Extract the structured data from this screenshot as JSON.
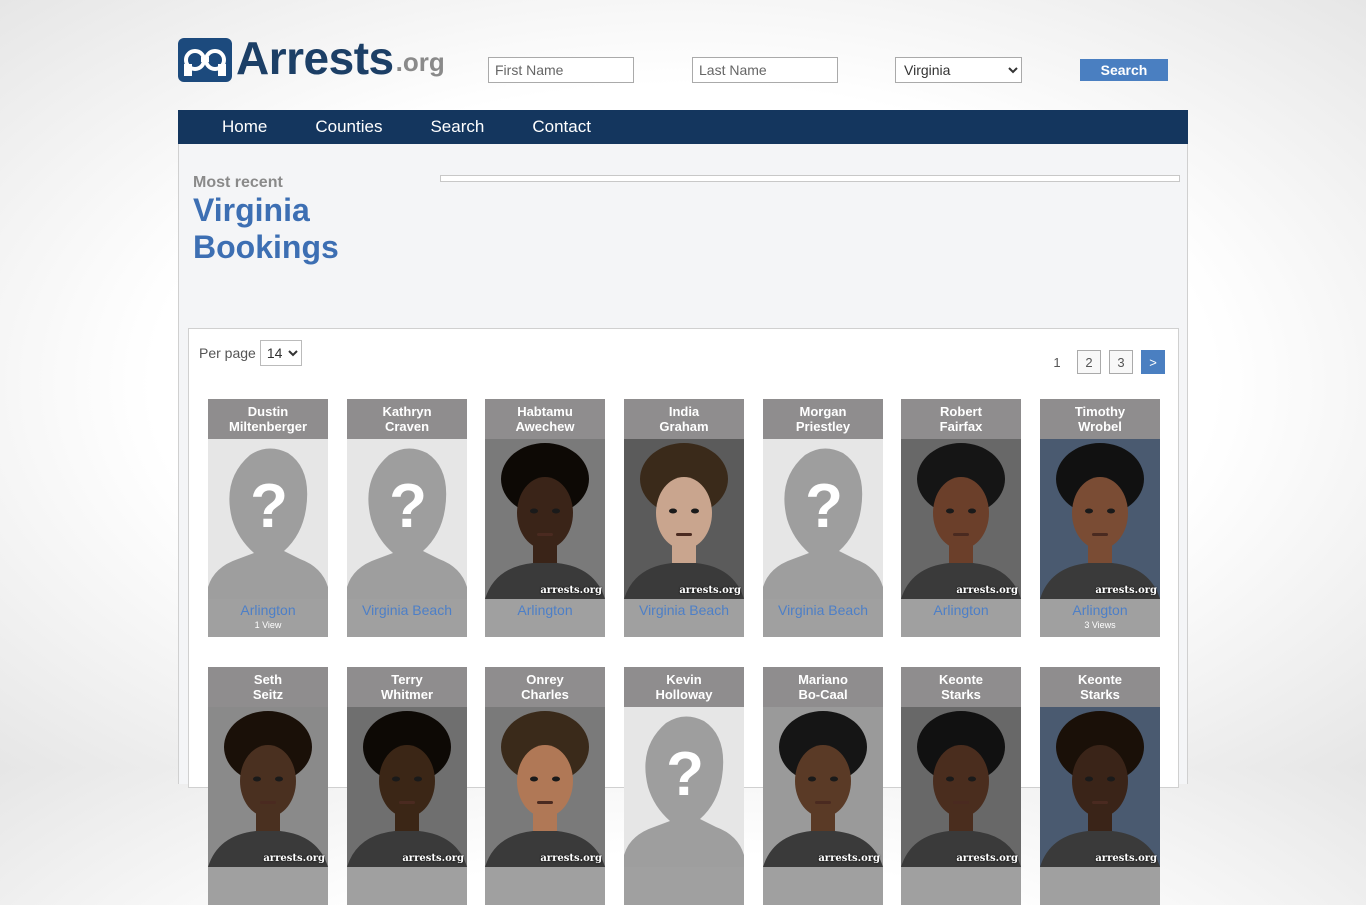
{
  "site": {
    "logo_text": "Arrests",
    "logo_tld": ".org"
  },
  "search": {
    "first_name_placeholder": "First Name",
    "last_name_placeholder": "Last Name",
    "state_selected": "Virginia",
    "button_label": "Search"
  },
  "nav": [
    "Home",
    "Counties",
    "Search",
    "Contact"
  ],
  "page": {
    "kicker": "Most recent",
    "title_line1": "Virginia",
    "title_line2": "Bookings"
  },
  "listing": {
    "per_page_label": "Per page",
    "per_page_value": "14",
    "pagination": {
      "current": "1",
      "pages": [
        "2",
        "3"
      ],
      "next": ">"
    }
  },
  "watermark": "arrests.org",
  "bookings": [
    {
      "first": "Dustin",
      "last": "Miltenberger",
      "county": "Arlington",
      "views": "1 View",
      "photo": "placeholder"
    },
    {
      "first": "Kathryn",
      "last": "Craven",
      "county": "Virginia Beach",
      "views": "",
      "photo": "placeholder"
    },
    {
      "first": "Habtamu",
      "last": "Awechew",
      "county": "Arlington",
      "views": "",
      "photo": "mugshot"
    },
    {
      "first": "India",
      "last": "Graham",
      "county": "Virginia Beach",
      "views": "",
      "photo": "mugshot"
    },
    {
      "first": "Morgan",
      "last": "Priestley",
      "county": "Virginia Beach",
      "views": "",
      "photo": "placeholder"
    },
    {
      "first": "Robert",
      "last": "Fairfax",
      "county": "Arlington",
      "views": "",
      "photo": "mugshot"
    },
    {
      "first": "Timothy",
      "last": "Wrobel",
      "county": "Arlington",
      "views": "3 Views",
      "photo": "mugshot"
    },
    {
      "first": "Seth",
      "last": "Seitz",
      "county": "",
      "views": "",
      "photo": "mugshot"
    },
    {
      "first": "Terry",
      "last": "Whitmer",
      "county": "",
      "views": "",
      "photo": "mugshot"
    },
    {
      "first": "Onrey",
      "last": "Charles",
      "county": "",
      "views": "",
      "photo": "mugshot"
    },
    {
      "first": "Kevin",
      "last": "Holloway",
      "county": "",
      "views": "",
      "photo": "placeholder"
    },
    {
      "first": "Mariano",
      "last": "Bo-Caal",
      "county": "",
      "views": "",
      "photo": "mugshot"
    },
    {
      "first": "Keonte",
      "last": "Starks",
      "county": "",
      "views": "",
      "photo": "mugshot"
    },
    {
      "first": "Keonte",
      "last": "Starks",
      "county": "",
      "views": "",
      "photo": "mugshot"
    }
  ],
  "colors": {
    "nav_bg": "#14365e",
    "accent": "#4a7fc1",
    "title": "#3d6fb3",
    "card_header": "#8f8d8e"
  }
}
